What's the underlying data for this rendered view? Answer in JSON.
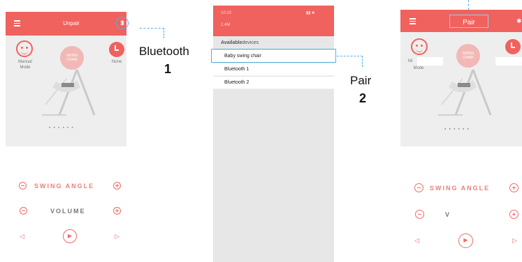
{
  "screen1": {
    "header_title": "Unpair",
    "left_label_1": "Manual",
    "left_label_2": "Mode",
    "right_label": "None",
    "center_badge_1": "SWING",
    "center_badge_2": "CHAIR",
    "swing_angle_label": "SWING ANGLE",
    "volume_label": "VOLUME"
  },
  "callout1": {
    "text": "Bluetooth",
    "number": "1"
  },
  "screen2": {
    "status_left": "10:10",
    "status_sub": "2.4M",
    "section_title_bold": "Available",
    "section_title_rest": "devices",
    "devices": [
      "Baby swing chair",
      "Bluetooth 1",
      "Bluetooth 2"
    ]
  },
  "callout2": {
    "text": "Pair",
    "number": "2"
  },
  "screen3": {
    "header_title": "Pair",
    "left_label_1": "Mi",
    "left_label_2": "Mode",
    "center_badge_1": "SWING",
    "center_badge_2": "CHAIR",
    "swing_angle_label": "SWING ANGLE",
    "volume_label": "V"
  },
  "colors": {
    "accent": "#f0625e",
    "callout_line": "#54b3e0"
  }
}
